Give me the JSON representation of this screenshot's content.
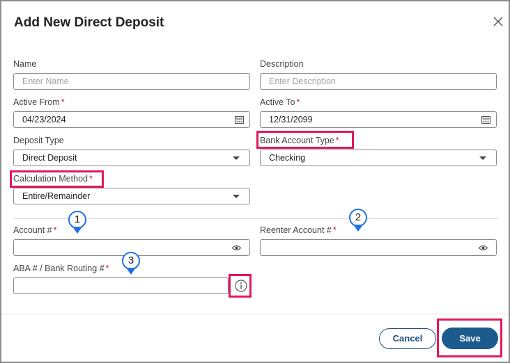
{
  "dialog": {
    "title": "Add New Direct Deposit"
  },
  "form": {
    "name": {
      "label": "Name",
      "placeholder": "Enter Name",
      "value": ""
    },
    "description": {
      "label": "Description",
      "placeholder": "Enter Description",
      "value": ""
    },
    "active_from": {
      "label": "Active From",
      "value": "04/23/2024"
    },
    "active_to": {
      "label": "Active To",
      "value": "12/31/2099"
    },
    "deposit_type": {
      "label": "Deposit Type",
      "value": "Direct Deposit"
    },
    "bank_account_type": {
      "label": "Bank Account Type",
      "value": "Checking"
    },
    "calculation_method": {
      "label": "Calculation Method",
      "value": "Entire/Remainder"
    },
    "account_number": {
      "label": "Account #",
      "value": ""
    },
    "reenter_account": {
      "label": "Reenter Account #",
      "value": ""
    },
    "aba_routing": {
      "label": "ABA # / Bank Routing #",
      "value": ""
    },
    "required_mark": "*"
  },
  "callouts": [
    "1",
    "2",
    "3"
  ],
  "footer": {
    "cancel_label": "Cancel",
    "save_label": "Save"
  },
  "colors": {
    "highlight": "#e0195a",
    "callout": "#1f72e8",
    "primary": "#1d5a8e",
    "required": "#c0143c"
  },
  "icons": {
    "close": "close-icon",
    "calendar": "calendar-icon",
    "dropdown": "chevron-down-icon",
    "visibility": "eye-icon",
    "info": "info-icon"
  }
}
